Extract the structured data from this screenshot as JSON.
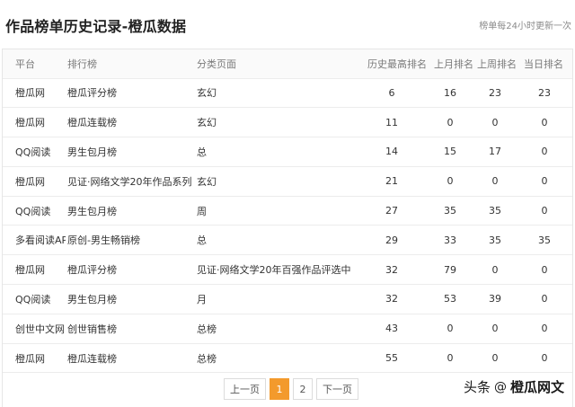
{
  "header": {
    "title": "作品榜单历史记录-橙瓜数据",
    "update_note": "榜单每24小时更新一次"
  },
  "table": {
    "columns": [
      "平台",
      "排行榜",
      "分类页面",
      "历史最高排名",
      "上月排名",
      "上周排名",
      "当日排名"
    ],
    "rows": [
      [
        "橙瓜网",
        "橙瓜评分榜",
        "玄幻",
        "6",
        "16",
        "23",
        "23"
      ],
      [
        "橙瓜网",
        "橙瓜连载榜",
        "玄幻",
        "11",
        "0",
        "0",
        "0"
      ],
      [
        "QQ阅读",
        "男生包月榜",
        "总",
        "14",
        "15",
        "17",
        "0"
      ],
      [
        "橙瓜网",
        "见证·网络文学20年作品系列",
        "玄幻",
        "21",
        "0",
        "0",
        "0"
      ],
      [
        "QQ阅读",
        "男生包月榜",
        "周",
        "27",
        "35",
        "35",
        "0"
      ],
      [
        "多看阅读APP",
        "原创-男生畅销榜",
        "总",
        "29",
        "33",
        "35",
        "35"
      ],
      [
        "橙瓜网",
        "橙瓜评分榜",
        "见证·网络文学20年百强作品评选中",
        "32",
        "79",
        "0",
        "0"
      ],
      [
        "QQ阅读",
        "男生包月榜",
        "月",
        "32",
        "53",
        "39",
        "0"
      ],
      [
        "创世中文网",
        "创世销售榜",
        "总榜",
        "43",
        "0",
        "0",
        "0"
      ],
      [
        "橙瓜网",
        "橙瓜连载榜",
        "总榜",
        "55",
        "0",
        "0",
        "0"
      ]
    ]
  },
  "pagination": {
    "prev_label": "上一页",
    "pages": [
      "1",
      "2"
    ],
    "current": "1",
    "next_label": "下一页"
  },
  "watermark": {
    "brand": "头条",
    "at": "@",
    "name": "橙瓜网文"
  },
  "colors": {
    "accent": "#f39a2c",
    "border": "#ececec",
    "header_text": "#7a7a7a"
  }
}
